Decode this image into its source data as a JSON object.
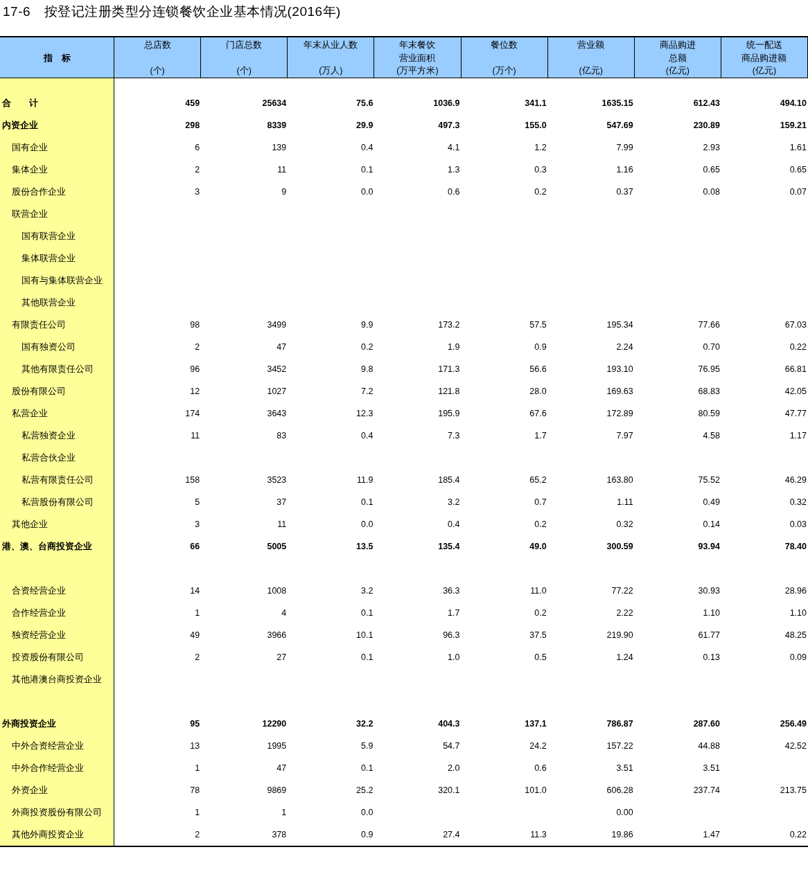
{
  "title": "17-6　按登记注册类型分连锁餐饮企业基本情况(2016年)",
  "table": {
    "row_header": "指　标",
    "columns": [
      {
        "lines": [
          "总店数",
          "(个)"
        ]
      },
      {
        "lines": [
          "门店总数",
          "(个)"
        ]
      },
      {
        "lines": [
          "年末从业人数",
          "(万人)"
        ]
      },
      {
        "lines": [
          "年末餐饮",
          "营业面积",
          "(万平方米)"
        ]
      },
      {
        "lines": [
          "餐位数",
          "(万个)"
        ]
      },
      {
        "lines": [
          "营业额",
          "(亿元)"
        ]
      },
      {
        "lines": [
          "商品购进",
          "总额",
          "(亿元)"
        ]
      },
      {
        "lines": [
          "统一配送",
          "商品购进额",
          "(亿元)"
        ]
      }
    ],
    "rows": [
      {
        "label": "合　　计",
        "values": {
          "column_1": "459",
          "column_2": "25634",
          "column_3": "75.6",
          "column_4": "1036.9",
          "column_5": "341.1",
          "column_6": "1635.15",
          "column_7": "612.43",
          "column_8": "494.10"
        }
      },
      {
        "label": "内资企业",
        "values": {
          "column_1": "298",
          "column_2": "8339",
          "column_3": "29.9",
          "column_4": "497.3",
          "column_5": "155.0",
          "column_6": "547.69",
          "column_7": "230.89",
          "column_8": "159.21"
        },
        "children": [
          {
            "label": "国有企业",
            "values": {
              "column_1": "6",
              "column_2": "139",
              "column_3": "0.4",
              "column_4": "4.1",
              "column_5": "1.2",
              "column_6": "7.99",
              "column_7": "2.93",
              "column_8": "1.61"
            }
          },
          {
            "label": "集体企业",
            "values": {
              "column_1": "2",
              "column_2": "11",
              "column_3": "0.1",
              "column_4": "1.3",
              "column_5": "0.3",
              "column_6": "1.16",
              "column_7": "0.65",
              "column_8": "0.65"
            }
          },
          {
            "label": "股份合作企业",
            "values": {
              "column_1": "3",
              "column_2": "9",
              "column_3": "0.0",
              "column_4": "0.6",
              "column_5": "0.2",
              "column_6": "0.37",
              "column_7": "0.08",
              "column_8": "0.07"
            }
          },
          {
            "label": "联营企业",
            "children": [
              {
                "label": "国有联营企业"
              },
              {
                "label": "集体联营企业"
              },
              {
                "label": "国有与集体联营企业"
              },
              {
                "label": "其他联营企业"
              }
            ]
          },
          {
            "label": "有限责任公司",
            "values": {
              "column_1": "98",
              "column_2": "3499",
              "column_3": "9.9",
              "column_4": "173.2",
              "column_5": "57.5",
              "column_6": "195.34",
              "column_7": "77.66",
              "column_8": "67.03"
            },
            "children": [
              {
                "label": "国有独资公司",
                "values": {
                  "column_1": "2",
                  "column_2": "47",
                  "column_3": "0.2",
                  "column_4": "1.9",
                  "column_5": "0.9",
                  "column_6": "2.24",
                  "column_7": "0.70",
                  "column_8": "0.22"
                }
              },
              {
                "label": "其他有限责任公司",
                "values": {
                  "column_1": "96",
                  "column_2": "3452",
                  "column_3": "9.8",
                  "column_4": "171.3",
                  "column_5": "56.6",
                  "column_6": "193.10",
                  "column_7": "76.95",
                  "column_8": "66.81"
                }
              }
            ]
          },
          {
            "label": "股份有限公司",
            "values": {
              "column_1": "12",
              "column_2": "1027",
              "column_3": "7.2",
              "column_4": "121.8",
              "column_5": "28.0",
              "column_6": "169.63",
              "column_7": "68.83",
              "column_8": "42.05"
            }
          },
          {
            "label": "私营企业",
            "values": {
              "column_1": "174",
              "column_2": "3643",
              "column_3": "12.3",
              "column_4": "195.9",
              "column_5": "67.6",
              "column_6": "172.89",
              "column_7": "80.59",
              "column_8": "47.77"
            },
            "children": [
              {
                "label": "私营独资企业",
                "values": {
                  "column_1": "11",
                  "column_2": "83",
                  "column_3": "0.4",
                  "column_4": "7.3",
                  "column_5": "1.7",
                  "column_6": "7.97",
                  "column_7": "4.58",
                  "column_8": "1.17"
                }
              },
              {
                "label": "私营合伙企业"
              },
              {
                "label": "私营有限责任公司",
                "values": {
                  "column_1": "158",
                  "column_2": "3523",
                  "column_3": "11.9",
                  "column_4": "185.4",
                  "column_5": "65.2",
                  "column_6": "163.80",
                  "column_7": "75.52",
                  "column_8": "46.29"
                }
              },
              {
                "label": "私营股份有限公司",
                "values": {
                  "column_1": "5",
                  "column_2": "37",
                  "column_3": "0.1",
                  "column_4": "3.2",
                  "column_5": "0.7",
                  "column_6": "1.11",
                  "column_7": "0.49",
                  "column_8": "0.32"
                }
              }
            ]
          },
          {
            "label": "其他企业",
            "values": {
              "column_1": "3",
              "column_2": "11",
              "column_3": "0.0",
              "column_4": "0.4",
              "column_5": "0.2",
              "column_6": "0.32",
              "column_7": "0.14",
              "column_8": "0.03"
            }
          }
        ]
      },
      {
        "label": "港、澳、台商投资企业",
        "values": {
          "column_1": "66",
          "column_2": "5005",
          "column_3": "13.5",
          "column_4": "135.4",
          "column_5": "49.0",
          "column_6": "300.59",
          "column_7": "93.94",
          "column_8": "78.40"
        },
        "blank_row_after": true,
        "children": [
          {
            "label": "合资经营企业",
            "values": {
              "column_1": "14",
              "column_2": "1008",
              "column_3": "3.2",
              "column_4": "36.3",
              "column_5": "11.0",
              "column_6": "77.22",
              "column_7": "30.93",
              "column_8": "28.96"
            }
          },
          {
            "label": "合作经营企业",
            "values": {
              "column_1": "1",
              "column_2": "4",
              "column_3": "0.1",
              "column_4": "1.7",
              "column_5": "0.2",
              "column_6": "2.22",
              "column_7": "1.10",
              "column_8": "1.10"
            }
          },
          {
            "label": "独资经营企业",
            "values": {
              "column_1": "49",
              "column_2": "3966",
              "column_3": "10.1",
              "column_4": "96.3",
              "column_5": "37.5",
              "column_6": "219.90",
              "column_7": "61.77",
              "column_8": "48.25"
            }
          },
          {
            "label": "投资股份有限公司",
            "values": {
              "column_1": "2",
              "column_2": "27",
              "column_3": "0.1",
              "column_4": "1.0",
              "column_5": "0.5",
              "column_6": "1.24",
              "column_7": "0.13",
              "column_8": "0.09"
            }
          },
          {
            "label": "其他港澳台商投资企业",
            "blank_row_after": true
          }
        ]
      },
      {
        "label": "外商投资企业",
        "values": {
          "column_1": "95",
          "column_2": "12290",
          "column_3": "32.2",
          "column_4": "404.3",
          "column_5": "137.1",
          "column_6": "786.87",
          "column_7": "287.60",
          "column_8": "256.49"
        },
        "children": [
          {
            "label": "中外合资经营企业",
            "values": {
              "column_1": "13",
              "column_2": "1995",
              "column_3": "5.9",
              "column_4": "54.7",
              "column_5": "24.2",
              "column_6": "157.22",
              "column_7": "44.88",
              "column_8": "42.52"
            }
          },
          {
            "label": "中外合作经营企业",
            "values": {
              "column_1": "1",
              "column_2": "47",
              "column_3": "0.1",
              "column_4": "2.0",
              "column_5": "0.6",
              "column_6": "3.51",
              "column_7": "3.51"
            }
          },
          {
            "label": "外资企业",
            "values": {
              "column_1": "78",
              "column_2": "9869",
              "column_3": "25.2",
              "column_4": "320.1",
              "column_5": "101.0",
              "column_6": "606.28",
              "column_7": "237.74",
              "column_8": "213.75"
            }
          },
          {
            "label": "外商投资股份有限公司",
            "values": {
              "column_1": "1",
              "column_2": "1",
              "column_3": "0.0",
              "column_6": "0.00"
            }
          },
          {
            "label": "其他外商投资企业",
            "values": {
              "column_1": "2",
              "column_2": "378",
              "column_3": "0.9",
              "column_4": "27.4",
              "column_5": "11.3",
              "column_6": "19.86",
              "column_7": "1.47",
              "column_8": "0.22"
            }
          }
        ]
      }
    ]
  }
}
